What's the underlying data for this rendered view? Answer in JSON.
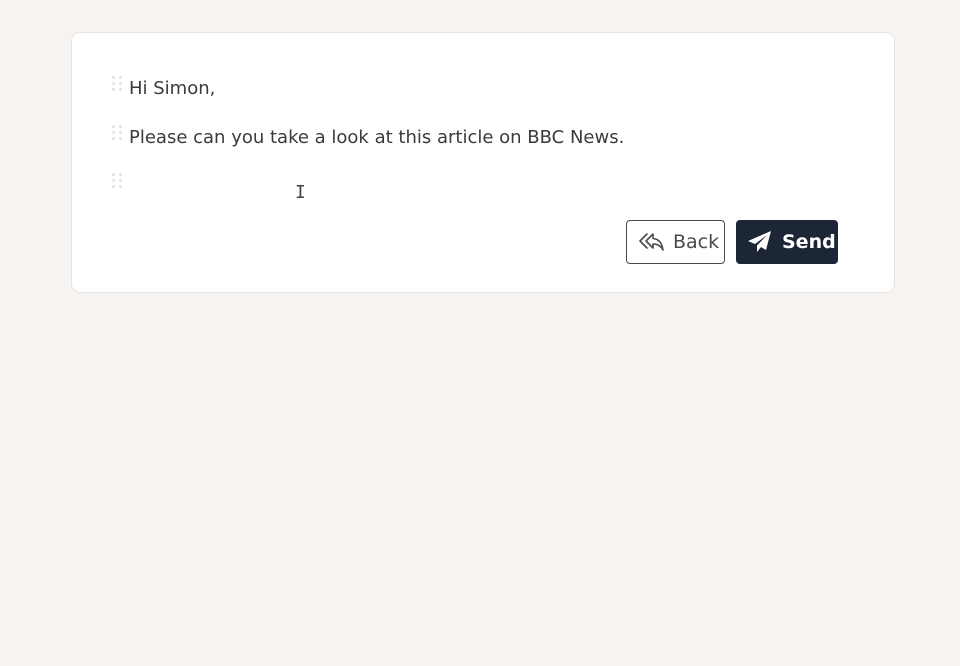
{
  "editor": {
    "blocks": [
      {
        "text": "Hi Simon,"
      },
      {
        "text": "Please can you take a look at this article on BBC News."
      },
      {
        "text": ""
      }
    ]
  },
  "actions": {
    "back_label": "Back",
    "send_label": "Send"
  },
  "colors": {
    "page_background": "#f7f3f0",
    "card_background": "#ffffff",
    "send_button": "#1d2636",
    "text": "#3a3a3a"
  },
  "icons": {
    "back": "reply-all-icon",
    "send": "paper-plane-icon",
    "drag": "drag-handle-icon"
  }
}
